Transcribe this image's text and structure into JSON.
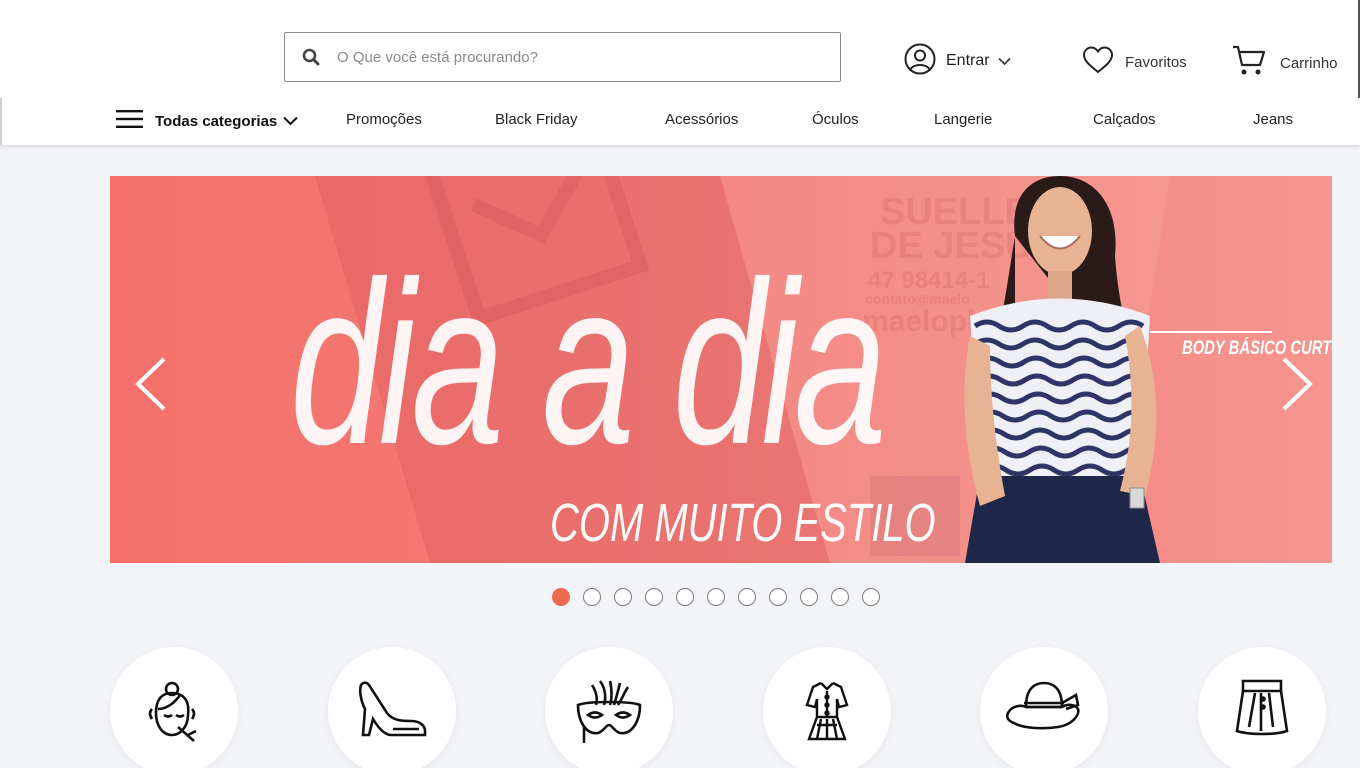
{
  "header": {
    "search": {
      "placeholder": "O Que você está procurando?",
      "value": ""
    },
    "account": {
      "label": "Entrar"
    },
    "favorites": {
      "label": "Favoritos"
    },
    "cart": {
      "label": "Carrinho"
    }
  },
  "nav": {
    "all_categories": "Todas categorias",
    "links": [
      "Promoções",
      "Black Friday",
      "Acessórios",
      "Óculos",
      "Langerie",
      "Calçados",
      "Jeans"
    ]
  },
  "banner": {
    "headline": "dia a dia",
    "subline": "COM MUITO ESTILO",
    "product_tag": "BODY BÁSICO CURTO",
    "watermark": [
      "SUELLEN",
      "DE JESUS",
      "47 98414-1",
      "contato@maelo",
      "maelopk"
    ]
  },
  "carousel": {
    "total_slides": 11,
    "active_index": 0
  },
  "categories": [
    {
      "icon": "makeup-face-icon"
    },
    {
      "icon": "high-heel-shoe-icon"
    },
    {
      "icon": "carnival-mask-icon"
    },
    {
      "icon": "dress-icon"
    },
    {
      "icon": "hat-icon"
    },
    {
      "icon": "skirt-icon"
    }
  ],
  "colors": {
    "accent": "#ee6a4f",
    "banner_bg": "#f47a73"
  }
}
